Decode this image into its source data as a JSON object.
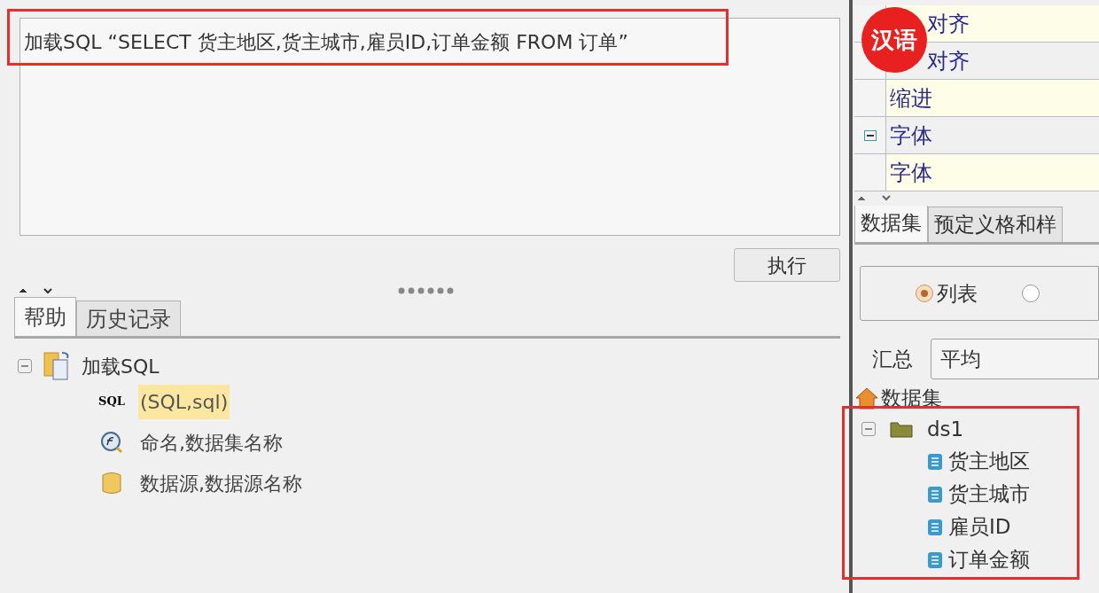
{
  "sql_editor": {
    "value": "加载SQL “SELECT 货主地区,货主城市,雇员ID,订单金额 FROM 订单”"
  },
  "execute_button": "执行",
  "bottom_tabs": [
    {
      "label": "帮助",
      "selected": true
    },
    {
      "label": "历史记录",
      "selected": false
    }
  ],
  "help_tree": {
    "label": "加载SQL",
    "expanded": true,
    "children": [
      {
        "kind": "sql",
        "icon_text": "SQL",
        "label": "(SQL,sql)",
        "highlighted": true
      },
      {
        "kind": "function",
        "label": "命名,数据集名称",
        "highlighted": false
      },
      {
        "kind": "database",
        "label": "数据源,数据源名称",
        "highlighted": false
      }
    ]
  },
  "properties": [
    {
      "label": "对齐"
    },
    {
      "label": "对齐"
    },
    {
      "label": "缩进"
    },
    {
      "label": "字体",
      "expanded": true
    },
    {
      "label": "字体"
    }
  ],
  "badge": "汉语",
  "right_tabs": [
    {
      "label": "数据集",
      "selected": true
    },
    {
      "label": "预定义格和样",
      "selected": false
    }
  ],
  "display_mode": [
    {
      "label": "列表",
      "selected": true
    },
    {
      "selected": false
    }
  ],
  "summary": {
    "label": "汇总",
    "value": "平均"
  },
  "dataset_tree": {
    "label": "数据集",
    "children": [
      {
        "label": "ds1",
        "expanded": true,
        "children": [
          {
            "label": "货主地区"
          },
          {
            "label": "货主城市"
          },
          {
            "label": "雇员ID"
          },
          {
            "label": "订单金额"
          }
        ]
      }
    ]
  }
}
